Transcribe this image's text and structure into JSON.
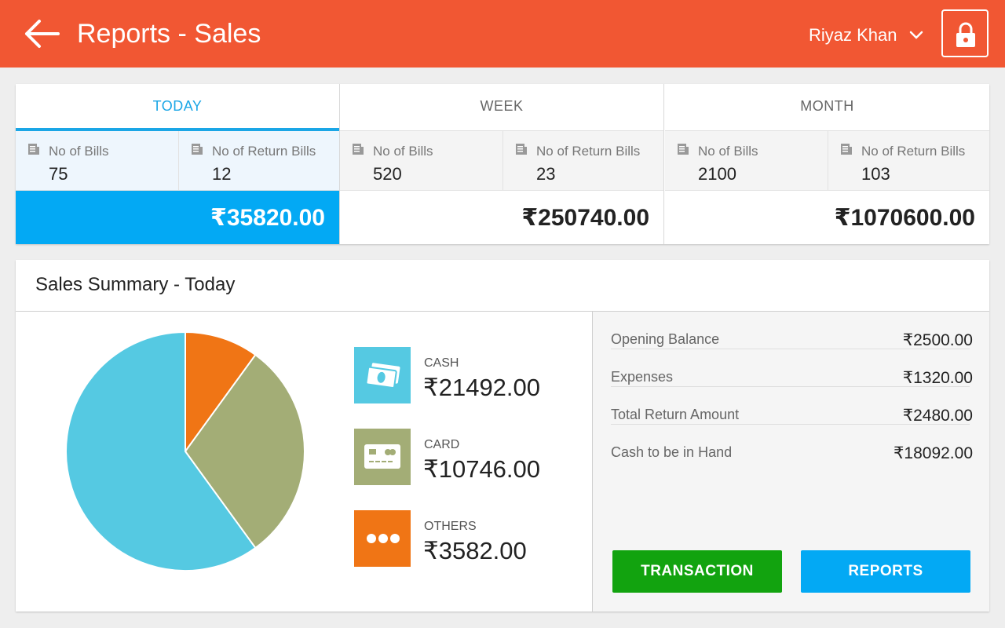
{
  "header": {
    "title": "Reports - Sales",
    "user_name": "Riyaz Khan",
    "icons": [
      "back-arrow-icon",
      "chevron-down-icon",
      "lock-icon"
    ]
  },
  "periods": [
    {
      "tab": "TODAY",
      "bills_label": "No of Bills",
      "bills": "75",
      "returns_label": "No of Return Bills",
      "returns": "12",
      "total": "₹35820.00",
      "active": true
    },
    {
      "tab": "WEEK",
      "bills_label": "No of Bills",
      "bills": "520",
      "returns_label": "No of Return Bills",
      "returns": "23",
      "total": "₹250740.00",
      "active": false
    },
    {
      "tab": "MONTH",
      "bills_label": "No of Bills",
      "bills": "2100",
      "returns_label": "No of Return Bills",
      "returns": "103",
      "total": "₹1070600.00",
      "active": false
    }
  ],
  "summary": {
    "title": "Sales Summary - Today",
    "payments": [
      {
        "label": "CASH",
        "amount": "₹21492.00",
        "color": "#55c9e2",
        "icon": "cash-icon"
      },
      {
        "label": "CARD",
        "amount": "₹10746.00",
        "color": "#a3ad76",
        "icon": "card-icon"
      },
      {
        "label": "OTHERS",
        "amount": "₹3582.00",
        "color": "#f07515",
        "icon": "more-dots-icon"
      }
    ],
    "balances": [
      {
        "label": "Opening Balance",
        "value": "₹2500.00"
      },
      {
        "label": "Expenses",
        "value": "₹1320.00"
      },
      {
        "label": "Total Return Amount",
        "value": "₹2480.00"
      },
      {
        "label": "Cash to be in Hand",
        "value": "₹18092.00"
      }
    ],
    "buttons": {
      "transaction": "TRANSACTION",
      "reports": "REPORTS"
    }
  },
  "chart_data": {
    "type": "pie",
    "categories": [
      "CASH",
      "CARD",
      "OTHERS"
    ],
    "values": [
      21492,
      10746,
      3582
    ],
    "colors": [
      "#55c9e2",
      "#a3ad76",
      "#f07515"
    ]
  },
  "colors": {
    "appbar": "#f15733",
    "accent": "#03a9f4",
    "transaction": "#12a30f"
  }
}
